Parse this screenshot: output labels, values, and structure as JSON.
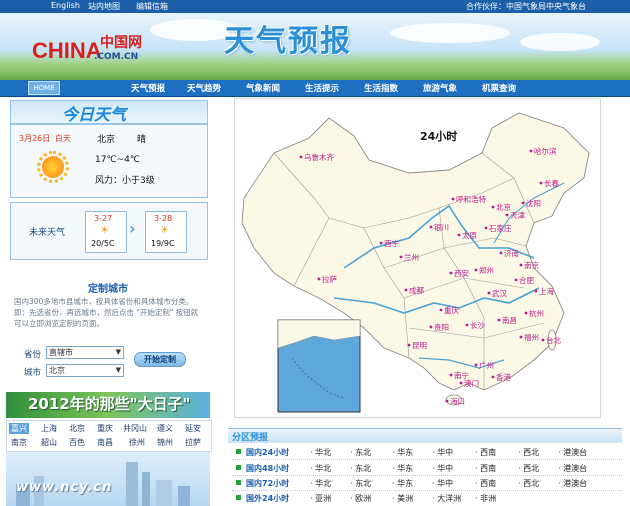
{
  "top_links": [
    "English",
    "站内地图",
    "编辑信箱"
  ],
  "partner": "合作伙伴：中国气象局中央气象台",
  "logo": {
    "brand": "CHINA",
    "cn": "中国网",
    "domain": ".COM.CN"
  },
  "banner_title": "天气预报",
  "nav": {
    "home": "HOME",
    "items": [
      "天气预报",
      "天气趋势",
      "气象新闻",
      "生活提示",
      "生活指数",
      "旅游气象",
      "机票查询"
    ]
  },
  "today": {
    "header": "今日天气",
    "date": "3月26日",
    "day": "白天",
    "city": "北京",
    "condition": "晴",
    "temp": "17℃~4℃",
    "wind": "风力：小于3级"
  },
  "future": {
    "label": "未来天气",
    "days": [
      {
        "date": "3-27",
        "temp": "20/5C"
      },
      {
        "date": "3-28",
        "temp": "19/9C"
      }
    ]
  },
  "custom": {
    "title": "定制城市",
    "desc": "国内300多地市县城市，按具体省份和具体城市分类。即：先选省份，再选城市，然后点击 \"开始定制\" 按钮就可以立即浏览定制的页面。",
    "province_label": "省份",
    "province_value": "直辖市",
    "city_label": "城市",
    "city_value": "北京",
    "button": "开始定制"
  },
  "banner2012": "2012年的那些\"大日子\"",
  "cities_row1": [
    "嘉兴",
    "上海",
    "北京",
    "重庆",
    "井冈山",
    "遵义",
    "延安"
  ],
  "cities_row2": [
    "南京",
    "韶山",
    "百色",
    "南昌",
    "徐州",
    "锦州",
    "拉萨"
  ],
  "watermark": "www.ncy.cn",
  "map": {
    "title": "24小时",
    "cities": [
      "乌鲁木齐",
      "哈尔滨",
      "长春",
      "沈阳",
      "呼和浩特",
      "北京",
      "天津",
      "石家庄",
      "太原",
      "银川",
      "西宁",
      "兰州",
      "济南",
      "郑州",
      "西安",
      "合肥",
      "南京",
      "上海",
      "武汉",
      "杭州",
      "成都",
      "重庆",
      "长沙",
      "南昌",
      "福州",
      "台北",
      "拉萨",
      "贵阳",
      "昆明",
      "南宁",
      "广州",
      "澳门",
      "香港",
      "海口"
    ]
  },
  "region": {
    "title": "分区预报",
    "rows": [
      {
        "label": "国内24小时",
        "cells": [
          "华北",
          "东北",
          "华东",
          "华中",
          "西南",
          "西北",
          "港澳台"
        ]
      },
      {
        "label": "国内48小时",
        "cells": [
          "华北",
          "东北",
          "华东",
          "华中",
          "西南",
          "西北",
          "港澳台"
        ]
      },
      {
        "label": "国内72小时",
        "cells": [
          "华北",
          "东北",
          "华东",
          "华中",
          "西南",
          "西北",
          "港澳台"
        ]
      },
      {
        "label": "国外24小时",
        "cells": [
          "亚洲",
          "欧洲",
          "美洲",
          "大洋洲",
          "非洲"
        ]
      }
    ]
  }
}
